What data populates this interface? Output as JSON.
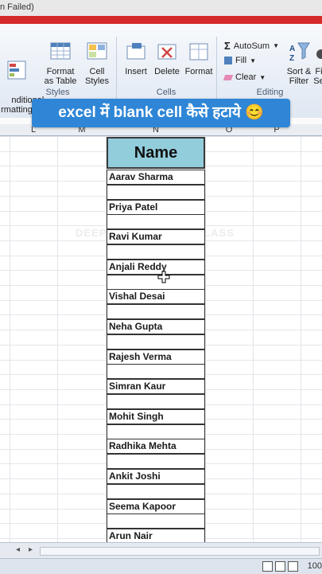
{
  "window": {
    "title_fragment": "n Failed)"
  },
  "caption": {
    "text": "excel में blank cell कैसे हटाये 😊"
  },
  "ribbon": {
    "styles_group": {
      "label": "Styles",
      "conditional": "nditional\nrmatting",
      "format_table": "Format\nas Table",
      "cell_styles": "Cell\nStyles"
    },
    "cells_group": {
      "label": "Cells",
      "insert": "Insert",
      "delete": "Delete",
      "format": "Format"
    },
    "editing_group": {
      "label": "Editing",
      "autosum": "AutoSum",
      "fill": "Fill",
      "clear": "Clear",
      "sort_filter": "Sort &\nFilter",
      "find_select": "Fi\nSe"
    }
  },
  "columns": {
    "l": "L",
    "m": "M",
    "n": "N",
    "o": "O",
    "p": "P"
  },
  "table": {
    "header": "Name",
    "names": [
      "Aarav Sharma",
      "Priya Patel",
      "Ravi Kumar",
      "Anjali Reddy",
      "Vishal Desai",
      "Neha Gupta",
      "Rajesh Verma",
      "Simran Kaur",
      "Mohit Singh",
      "Radhika Mehta",
      "Ankit Joshi",
      "Seema Kapoor",
      "Arun Nair"
    ]
  },
  "watermark": {
    "text": "DEEPAK COMPUTER CLASS"
  },
  "status": {
    "zoom": "100"
  }
}
